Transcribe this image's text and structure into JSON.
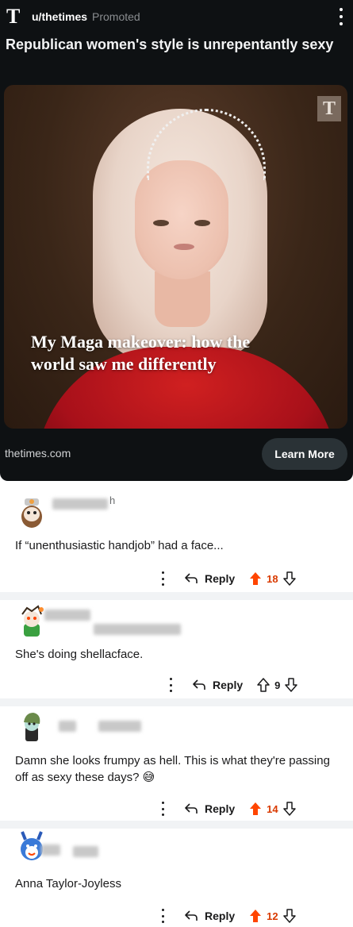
{
  "ad": {
    "logo": "T",
    "username": "u/thetimes",
    "promoted_label": "Promoted",
    "title": "Republican women's style is unrepentantly sexy",
    "image_headline": "My Maga makeover: how the world saw me differently",
    "image_badge": "T",
    "domain": "thetimes.com",
    "cta_label": "Learn More"
  },
  "comments": [
    {
      "username_suffix": "h",
      "text": "If “unenthusiastic handjob” had a face...",
      "reply_label": "Reply",
      "score": "18",
      "voted": "up"
    },
    {
      "username_suffix": "",
      "text": "She's doing shellacface.",
      "reply_label": "Reply",
      "score": "9",
      "voted": "none"
    },
    {
      "username_suffix": "",
      "text": "Damn she looks frumpy as hell. This is what they're passing off as sexy these days? 😅",
      "reply_label": "Reply",
      "score": "14",
      "voted": "up"
    },
    {
      "username_suffix": "",
      "text": "Anna Taylor-Joyless",
      "reply_label": "Reply",
      "score": "12",
      "voted": "up"
    }
  ],
  "colors": {
    "ad_background": "#0e1113",
    "upvote_active": "#ff4500",
    "score_active": "#d93a00",
    "divider": "#f1f3f5"
  },
  "icons": {
    "reply": "reply-arrow-icon",
    "upvote": "upvote-arrow-icon",
    "downvote": "downvote-arrow-icon",
    "more": "more-vertical-icon"
  }
}
